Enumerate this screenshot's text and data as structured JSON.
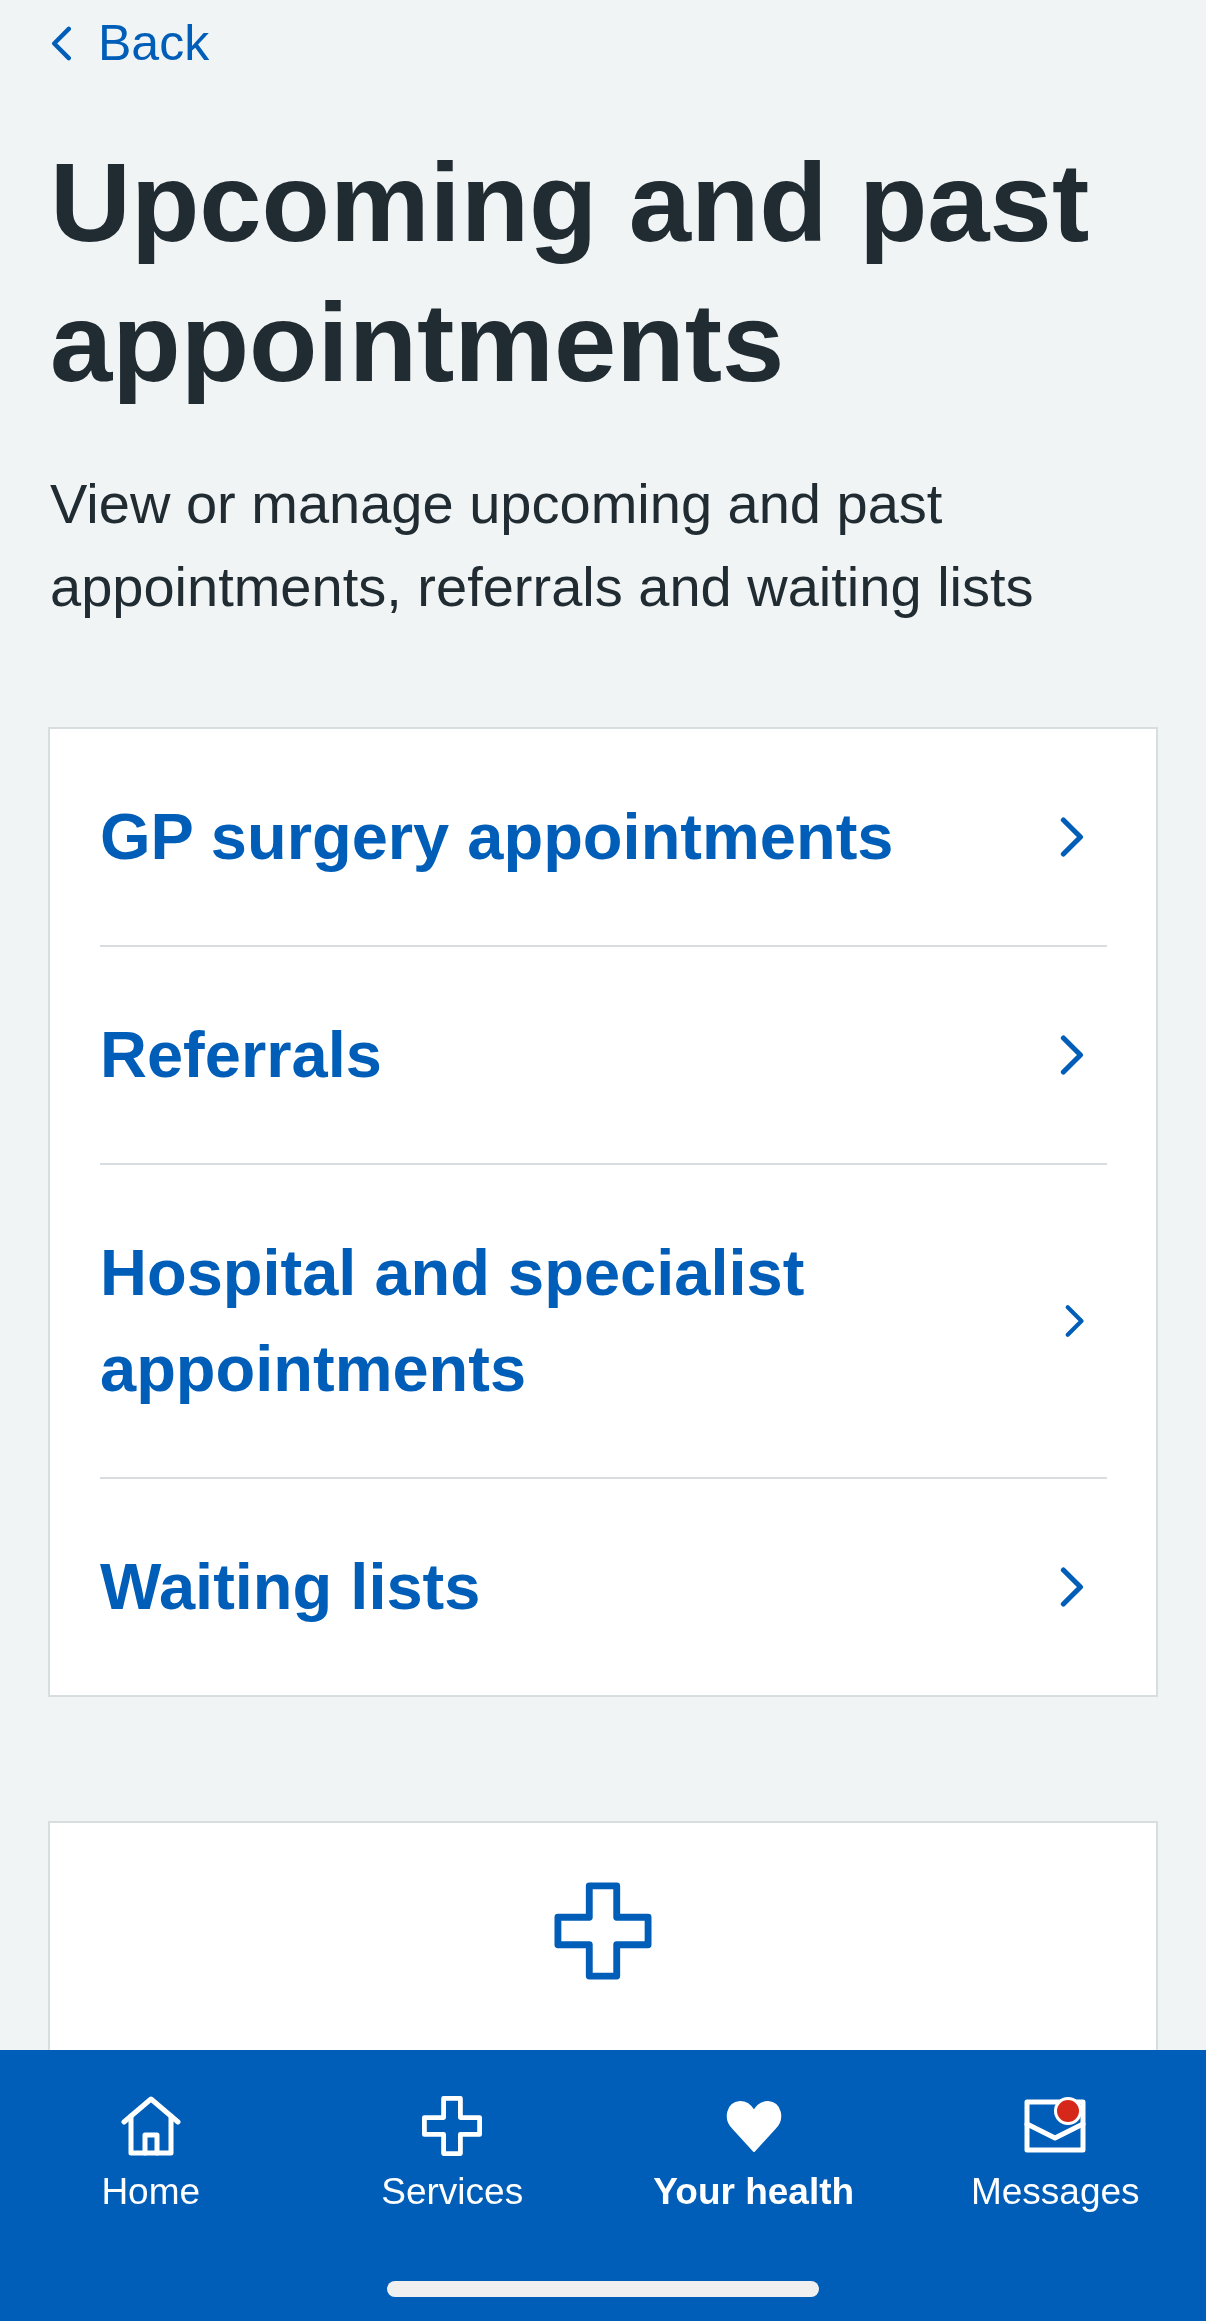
{
  "back_link": {
    "label": "Back"
  },
  "page": {
    "title": "Upcoming and past appointments",
    "description": "View or manage upcoming and past appointments, referrals and waiting lists"
  },
  "links": [
    {
      "label": "GP surgery appointments"
    },
    {
      "label": "Referrals"
    },
    {
      "label": "Hospital and specialist appointments"
    },
    {
      "label": "Waiting lists"
    }
  ],
  "bottom_nav": [
    {
      "label": "Home",
      "selected": false,
      "notification": false
    },
    {
      "label": "Services",
      "selected": false,
      "notification": false
    },
    {
      "label": "Your health",
      "selected": true,
      "notification": false
    },
    {
      "label": "Messages",
      "selected": false,
      "notification": true
    }
  ]
}
